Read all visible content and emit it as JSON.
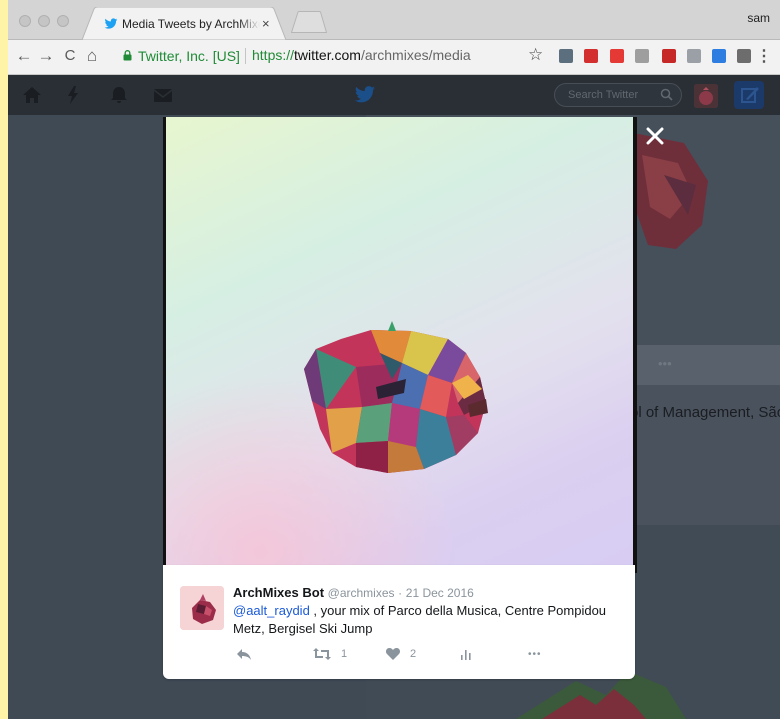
{
  "browser": {
    "tab_title": "Media Tweets by ArchMixes Bot",
    "tab_close": "×",
    "user_name": "sam",
    "security_label": "Twitter, Inc. [US]",
    "url_protocol": "https://",
    "url_host": "twitter.com",
    "url_path": "/archmixes/media",
    "nav": {
      "back": "←",
      "forward": "→",
      "reload": "C",
      "home": "⌂"
    },
    "bookmark": "☆",
    "menu": "⋮",
    "extensions": [
      {
        "name": "t-extension-icon",
        "color": "#5b6f7e"
      },
      {
        "name": "pinterest-icon",
        "color": "#d32f2f"
      },
      {
        "name": "opera-icon",
        "color": "#e53935"
      },
      {
        "name": "page-icon",
        "color": "#9e9e9e"
      },
      {
        "name": "bars-extension-icon",
        "color": "#c62828"
      },
      {
        "name": "cloud-icon",
        "color": "#9aa0a6"
      },
      {
        "name": "arrow-extension-icon",
        "color": "#2e7de0"
      },
      {
        "name": "camera-icon",
        "color": "#6d6d6d"
      }
    ]
  },
  "twitter_nav": {
    "search_placeholder": "Search Twitter",
    "icons": [
      "home-icon",
      "moments-icon",
      "notifications-icon",
      "messages-icon",
      "twitter-bird-icon"
    ]
  },
  "background": {
    "partial_text": "ol of Management, São",
    "more_dots": "•••"
  },
  "modal": {
    "close": "×",
    "tweet": {
      "author": "ArchMixes Bot",
      "handle": "@archmixes",
      "separator": "·",
      "date": "21 Dec 2016",
      "mention": "@aalt_raydid",
      "text": " , your mix of Parco della Musica, Centre Pompidou Metz, Bergisel Ski Jump",
      "retweets": "1",
      "likes": "2",
      "more": "•••"
    }
  }
}
